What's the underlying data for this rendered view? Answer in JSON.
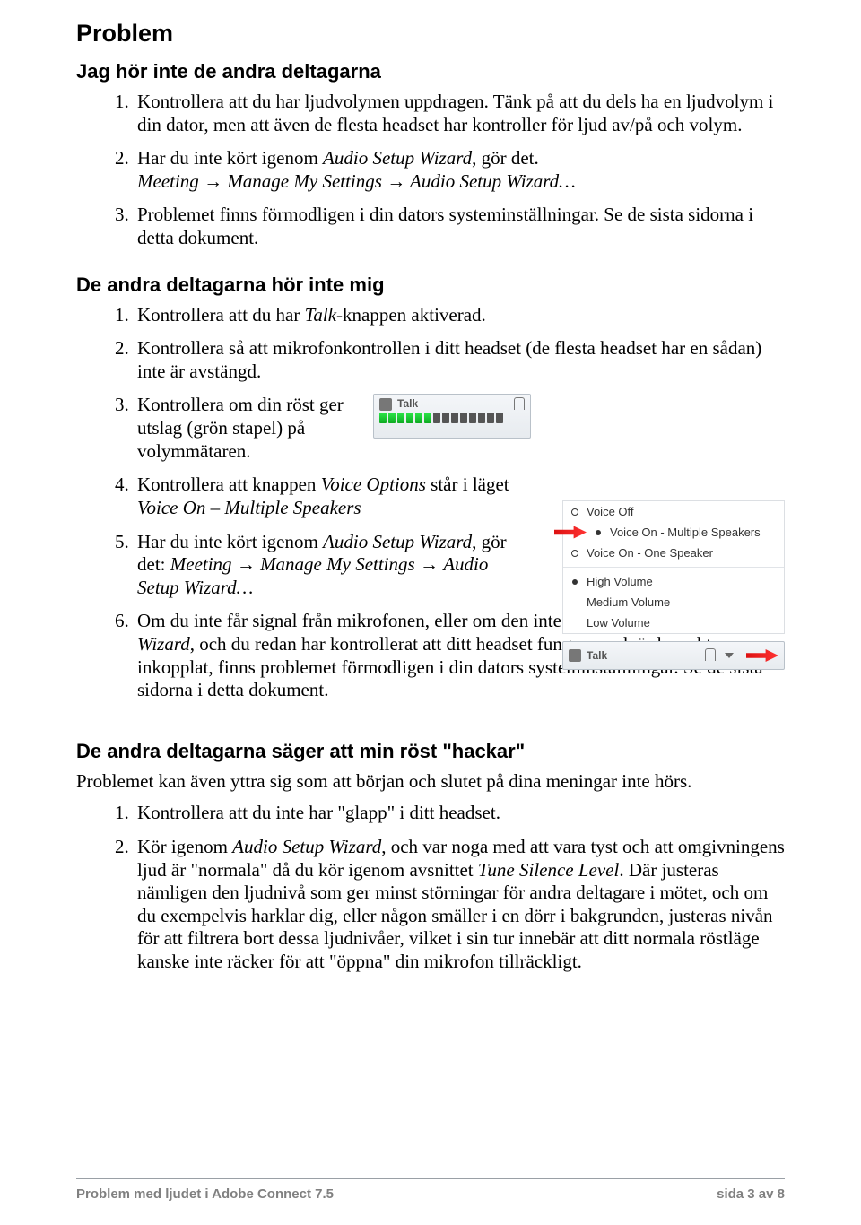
{
  "title": "Problem",
  "section1": {
    "heading": "Jag hör inte de andra deltagarna",
    "items": {
      "i1": "Kontrollera att du har ljudvolymen uppdragen. Tänk på att du dels ha en ljudvolym i din dator, men att även de flesta headset har kontroller för ljud av/på och volym.",
      "i2a": "Har du inte kört igenom ",
      "i2b": "Audio Setup Wizard",
      "i2c": ", gör det.",
      "i2d": "Meeting ",
      "i2e": " Manage My Settings ",
      "i2f": " Audio Setup Wizard…",
      "i3": "Problemet finns förmodligen i din dators systeminställningar. Se de sista sidorna i detta dokument."
    }
  },
  "section2": {
    "heading": "De andra deltagarna hör inte mig",
    "items": {
      "i1a": "Kontrollera att du har ",
      "i1b": "Talk",
      "i1c": "-knappen aktiverad.",
      "i2": "Kontrollera så att mikrofonkontrollen i ditt headset (de flesta headset har en sådan) inte är avstängd.",
      "i3": "Kontrollera om din röst ger utslag (grön stapel) på volymmätaren.",
      "i4a": "Kontrollera att knappen ",
      "i4b": "Voice Options",
      "i4c": " står i läget ",
      "i4d": "Voice On – Multiple Speakers",
      "i5a": "Har du inte kört igenom ",
      "i5b": "Audio Setup Wizard",
      "i5c": ", gör det: ",
      "i5d": "Meeting ",
      "i5e": " Manage My Settings ",
      "i5f": "Audio Setup Wizard…",
      "i6a": "Om du inte får signal från mikrofonen, eller om den inte är valbar i ",
      "i6b": "Audio Setup Wizard",
      "i6c": ", och du redan har kontrollerat att ditt headset fungerar och är korrekt inkopplat, finns problemet förmodligen i din datators systeminställningar. Se de sista sidorna i detta dokument.",
      "i6c_fixed": ", och du redan har kontrollerat att ditt headset fungerar och är korrekt inkopplat, finns problemet förmodligen i din dators systeminställningar. Se de sista sidorna i detta dokument."
    }
  },
  "section3": {
    "heading": "De andra deltagarna säger att min röst \"hackar\"",
    "intro": "Problemet kan även yttra sig som att början och slutet på dina meningar inte hörs.",
    "items": {
      "i1": "Kontrollera att du inte har \"glapp\" i ditt headset.",
      "i2a": "Kör igenom ",
      "i2b": "Audio Setup Wizard",
      "i2c": ", och var noga med att vara tyst och att omgivningens ljud är \"normala\" då du kör igenom avsnittet ",
      "i2d": "Tune Silence Level",
      "i2e": ". Där justeras nämligen den ljudnivå som ger minst störningar för andra deltagare i mötet, och om du exempelvis harklar dig, eller någon smäller i en dörr i bakgrunden, justeras nivån för att filtrera bort dessa ljudnivåer, vilket i sin tur innebär att ditt normala röstläge kanske inte räcker för att \"öppna\" din mikrofon tillräckligt."
    }
  },
  "talk_widget": {
    "label": "Talk"
  },
  "voice_menu": {
    "voice_off": "Voice Off",
    "voice_on_multi": "Voice On - Multiple Speakers",
    "voice_on_one": "Voice On - One Speaker",
    "high": "High Volume",
    "medium": "Medium Volume",
    "low": "Low Volume"
  },
  "talk_bar2": {
    "label": "Talk"
  },
  "arrow_glyph": "→",
  "footer": {
    "left": "Problem med ljudet i Adobe Connect 7.5",
    "right": "sida 3 av 8"
  }
}
